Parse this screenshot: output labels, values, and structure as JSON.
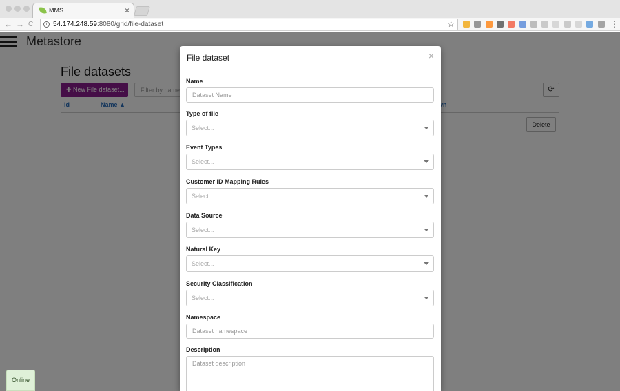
{
  "browser": {
    "tab_title": "MMS",
    "tab_close": "×",
    "url_host": "54.174.248.59",
    "url_rest": ":8080/grid/file-dataset",
    "nav_back": "←",
    "nav_forward": "→",
    "nav_reload": "C",
    "bookmark_icon": "☆",
    "menu_icon": "⋮",
    "extensions": [
      {
        "icon": "extension-icon",
        "color": "#f0a000"
      },
      {
        "icon": "info-circle-icon",
        "color": "#777777"
      },
      {
        "icon": "ghostery-icon",
        "color": "#ff7a00"
      },
      {
        "icon": "pocket-icon",
        "color": "#444444"
      },
      {
        "icon": "git-icon",
        "color": "#f05033"
      },
      {
        "icon": "chrome-icon",
        "color": "#4a7fd6"
      },
      {
        "icon": "extension-icon",
        "color": "#aaaaaa"
      },
      {
        "icon": "extension-icon",
        "color": "#bbbbbb"
      },
      {
        "icon": "extension-icon",
        "color": "#cccccc"
      },
      {
        "icon": "extension-icon",
        "color": "#bbbbbb"
      },
      {
        "icon": "extension-icon",
        "color": "#cccccc"
      },
      {
        "icon": "extension-icon",
        "color": "#4a90d9"
      },
      {
        "icon": "extension-icon",
        "color": "#888888"
      }
    ]
  },
  "app": {
    "title": "Metastore",
    "page_title": "File datasets",
    "new_button": "✚ New File dataset...",
    "filter_placeholder": "Filter by name",
    "refresh_icon": "⟳",
    "columns": {
      "id": "Id",
      "name": "Name ▲",
      "partial": "wn"
    },
    "delete_button": "Delete",
    "accent_color": "#8b1c8e"
  },
  "status": {
    "label": "Online"
  },
  "modal": {
    "title": "File dataset",
    "close": "×",
    "fields": {
      "name": {
        "label": "Name",
        "placeholder": "Dataset Name"
      },
      "type_of_file": {
        "label": "Type of file",
        "value": "Select..."
      },
      "event_types": {
        "label": "Event Types",
        "value": "Select..."
      },
      "customer_id_mapping": {
        "label": "Customer ID Mapping Rules",
        "value": "Select..."
      },
      "data_source": {
        "label": "Data Source",
        "value": "Select..."
      },
      "natural_key": {
        "label": "Natural Key",
        "value": "Select..."
      },
      "security_classification": {
        "label": "Security Classification",
        "value": "Select..."
      },
      "namespace": {
        "label": "Namespace",
        "placeholder": "Dataset namespace"
      },
      "description": {
        "label": "Description",
        "placeholder": "Dataset description"
      }
    }
  }
}
